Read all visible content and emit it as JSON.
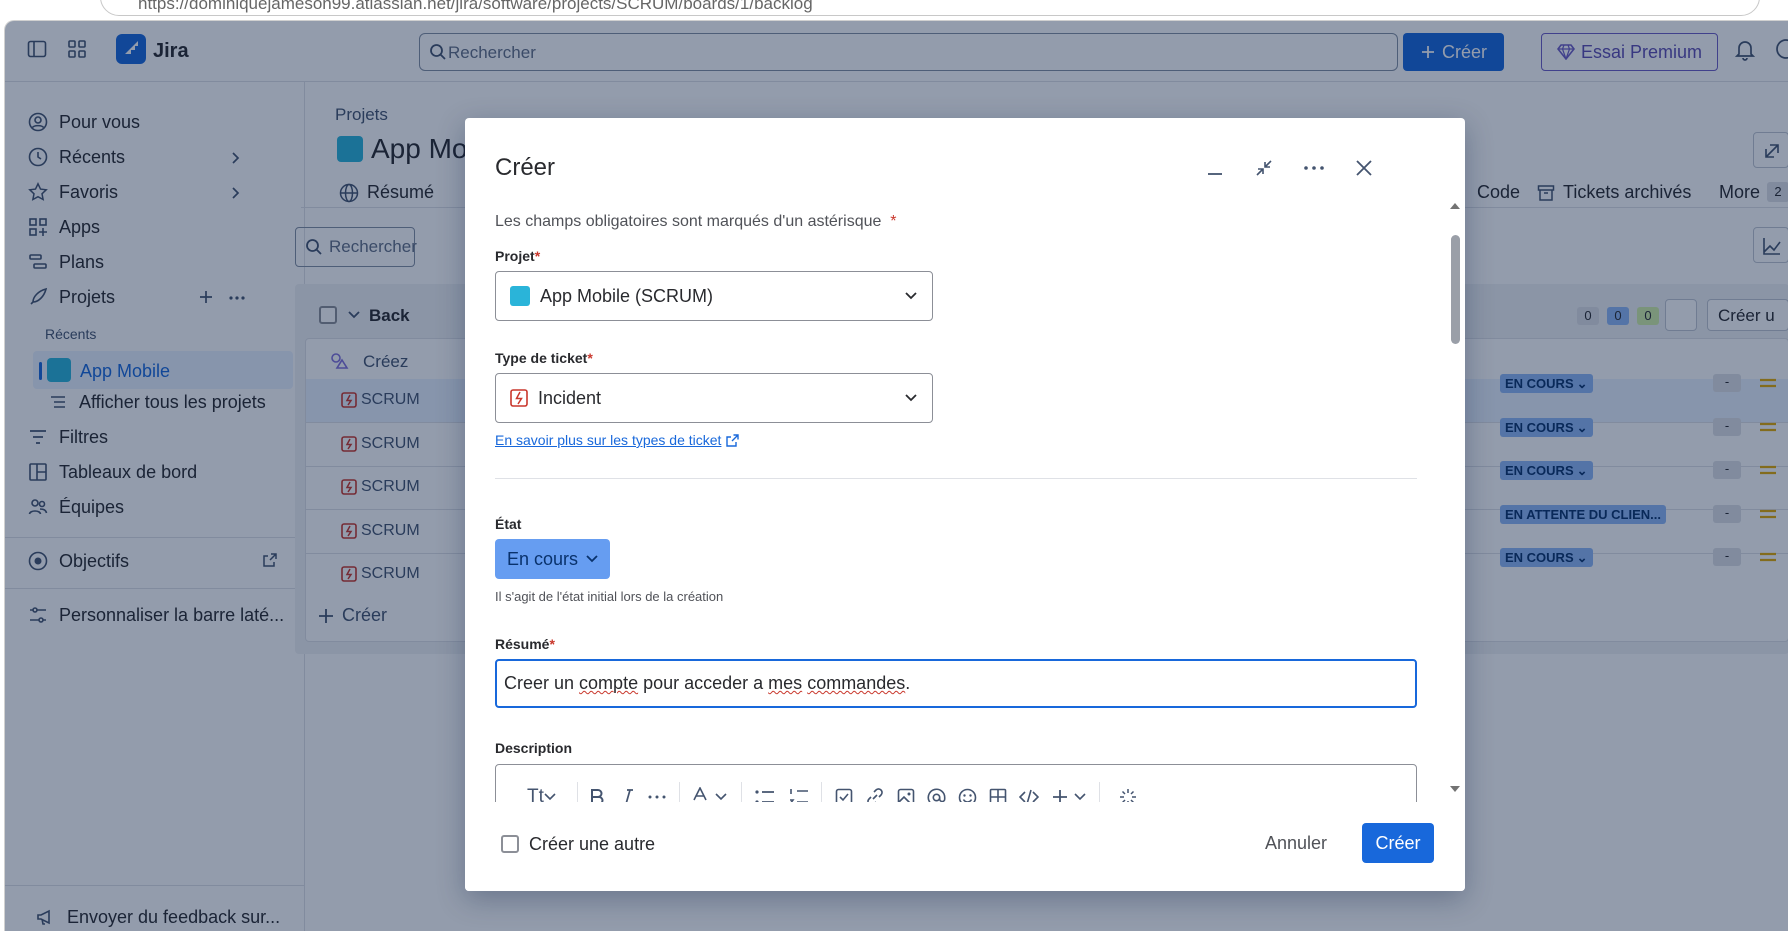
{
  "browser": {
    "url": "https://dominiquejameson99.atlassian.net/jira/software/projects/SCRUM/boards/1/backlog"
  },
  "topnav": {
    "app_name": "Jira",
    "search_placeholder": "Rechercher",
    "create_label": "Créer",
    "premium_label": "Essai Premium"
  },
  "sidebar": {
    "items": [
      {
        "label": "Pour vous"
      },
      {
        "label": "Récents"
      },
      {
        "label": "Favoris"
      },
      {
        "label": "Apps"
      },
      {
        "label": "Plans"
      },
      {
        "label": "Projets"
      }
    ],
    "recent_heading": "Récents",
    "active_project": "App Mobile",
    "all_projects": "Afficher tous les projets",
    "filters": "Filtres",
    "dashboards": "Tableaux de bord",
    "teams": "Équipes",
    "goals": "Objectifs",
    "customize": "Personnaliser la barre laté...",
    "feedback": "Envoyer du feedback sur..."
  },
  "background": {
    "breadcrumb": "Projets",
    "project_title": "App Mo",
    "tab_summary": "Résumé",
    "tab_code": "Code",
    "tab_archived": "Tickets archivés",
    "tab_more": "More",
    "more_count": "2",
    "search_placeholder": "Rechercher",
    "backlog_label": "Back",
    "count_gray": "0",
    "count_blue": "0",
    "count_green": "0",
    "create_sprint": "Créer u",
    "create_row": "Créez",
    "add_create": "Créer",
    "rows": [
      {
        "key": "SCRUM",
        "status": "EN COURS"
      },
      {
        "key": "SCRUM",
        "status": "EN COURS"
      },
      {
        "key": "SCRUM",
        "status": "EN COURS"
      },
      {
        "key": "SCRUM",
        "status": "EN ATTENTE DU CLIEN..."
      },
      {
        "key": "SCRUM",
        "status": "EN COURS"
      }
    ],
    "dash": "-"
  },
  "modal": {
    "title": "Créer",
    "required_note": "Les champs obligatoires sont marqués d'un astérisque",
    "asterisk": "*",
    "project_label": "Projet",
    "project_value": "App Mobile (SCRUM)",
    "type_label": "Type de ticket",
    "type_value": "Incident",
    "learn_more": "En savoir plus sur les types de ticket",
    "status_label": "État",
    "status_value": "En cours",
    "status_help": "Il s'agit de l'état initial lors de la création",
    "summary_label": "Résumé",
    "summary_parts": [
      "Creer un ",
      "compte",
      " pour acceder a ",
      "mes",
      " ",
      "commandes",
      "."
    ],
    "description_label": "Description",
    "toolbar_text_style": "Tt",
    "create_another": "Créer une autre",
    "cancel": "Annuler",
    "submit": "Créer"
  },
  "colors": {
    "brand": "#1868db",
    "status_fill": "#669df1",
    "danger": "#c9372c"
  }
}
